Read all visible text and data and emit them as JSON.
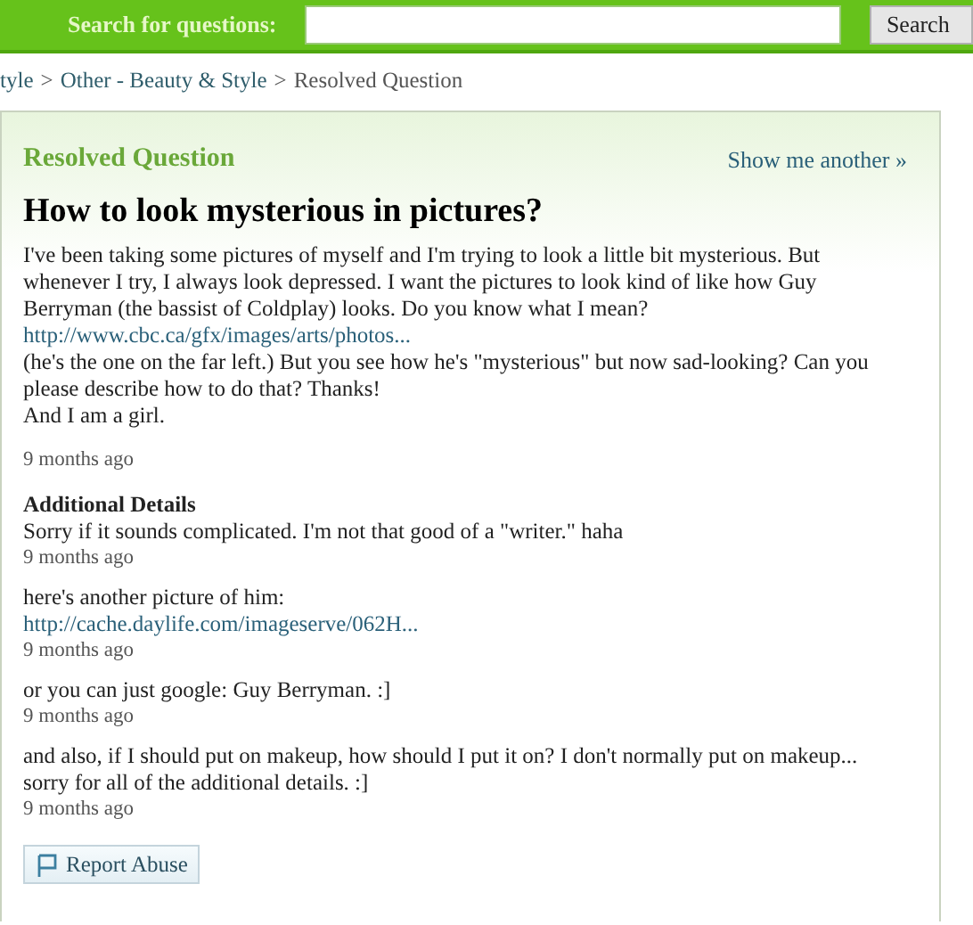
{
  "search": {
    "label": "Search for questions:",
    "button": "Search"
  },
  "breadcrumb": [
    {
      "text": "tyle",
      "kind": "link"
    },
    {
      "text": ">",
      "kind": "sep"
    },
    {
      "text": "Other - Beauty & Style",
      "kind": "link"
    },
    {
      "text": ">",
      "kind": "sep"
    },
    {
      "text": "Resolved Question",
      "kind": "current"
    }
  ],
  "card": {
    "heading": "Resolved Question",
    "show_another": "Show me another »",
    "title": "How to look mysterious in pictures?",
    "body": [
      {
        "kind": "text",
        "text": "I've been taking some pictures of myself and I'm trying to look a little bit mysterious. But whenever I try, I always look depressed. I want the pictures to look kind of like how Guy Berryman (the bassist of Coldplay) looks. Do you know what I mean?"
      },
      {
        "kind": "link",
        "text": "http://www.cbc.ca/gfx/images/arts/photos..."
      },
      {
        "kind": "text",
        "text": "(he's the one on the far left.) But you see how he's \"mysterious\" but now sad-looking? Can you please describe how to do that? Thanks!"
      },
      {
        "kind": "text",
        "text": "And I am a girl."
      }
    ],
    "time": "9 months ago",
    "details_heading": "Additional Details",
    "details": [
      {
        "blocks": [
          {
            "kind": "text",
            "text": "Sorry if it sounds complicated. I'm not that good of a \"writer.\" haha"
          }
        ],
        "time": "9 months ago"
      },
      {
        "blocks": [
          {
            "kind": "text",
            "text": "here's another picture of him:"
          },
          {
            "kind": "link",
            "text": "http://cache.daylife.com/imageserve/062H..."
          }
        ],
        "time": "9 months ago"
      },
      {
        "blocks": [
          {
            "kind": "text",
            "text": "or you can just google: Guy Berryman. :]"
          }
        ],
        "time": "9 months ago"
      },
      {
        "blocks": [
          {
            "kind": "text",
            "text": "and also, if I should put on makeup, how should I put it on? I don't normally put on makeup... sorry for all of the additional details. :]"
          }
        ],
        "time": "9 months ago"
      }
    ],
    "report": "Report Abuse"
  }
}
